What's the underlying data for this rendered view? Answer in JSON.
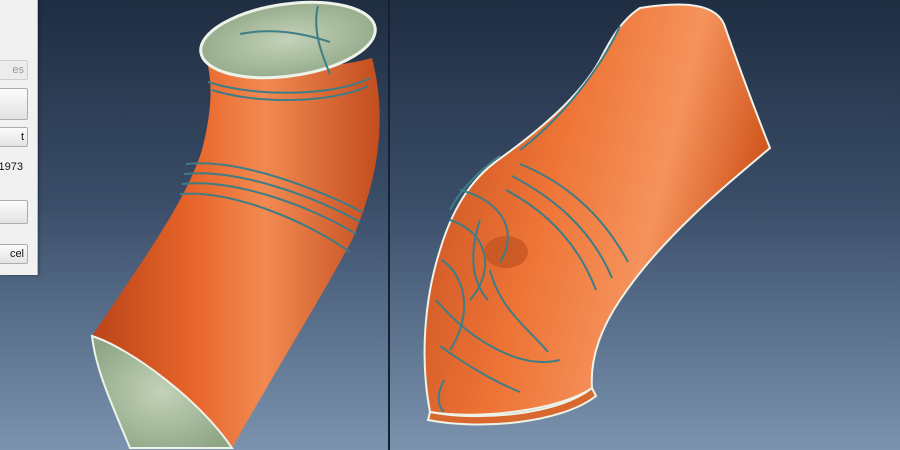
{
  "dialog": {
    "button_top_label": "es",
    "button_mid_label": "",
    "button_third_label": "t",
    "value_text": "1973",
    "button_fourth_label": "",
    "button_cancel_label": "cel"
  },
  "colors": {
    "model_surface": "#e8652a",
    "model_interior": "#a9bf9e",
    "seam_lines": "#3f7d86",
    "background_top": "#1f2d42",
    "background_bottom": "#7b93ae"
  },
  "viewports": {
    "left": {
      "model": "bent-pipe-elbow"
    },
    "right": {
      "model": "deformed-pipe-elbow"
    }
  }
}
